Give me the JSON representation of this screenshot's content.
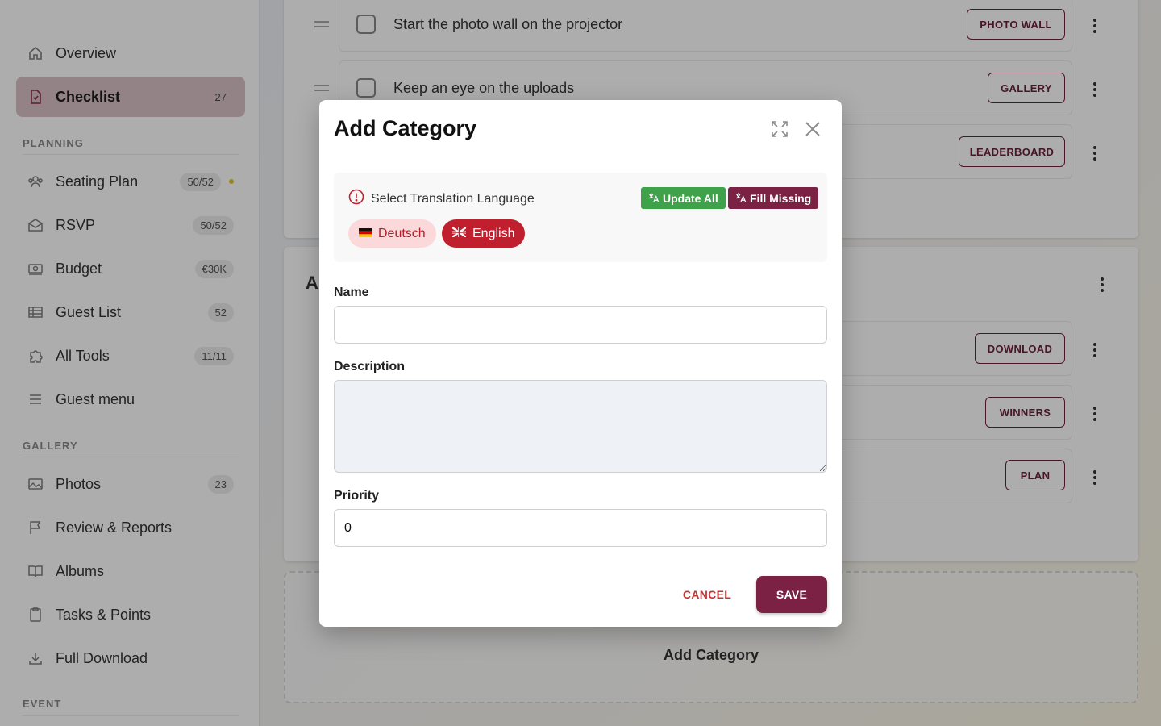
{
  "sidebar": {
    "overview": {
      "label": "Overview"
    },
    "checklist": {
      "label": "Checklist",
      "badge": "27"
    },
    "planning_head": "PLANNING",
    "seating": {
      "label": "Seating Plan",
      "badge": "50/52"
    },
    "rsvp": {
      "label": "RSVP",
      "badge": "50/52"
    },
    "budget": {
      "label": "Budget",
      "badge": "€30K"
    },
    "guest_list": {
      "label": "Guest List",
      "badge": "52"
    },
    "all_tools": {
      "label": "All Tools",
      "badge": "11/11"
    },
    "guest_menu": {
      "label": "Guest menu"
    },
    "gallery_head": "GALLERY",
    "photos": {
      "label": "Photos",
      "badge": "23"
    },
    "review": {
      "label": "Review & Reports"
    },
    "albums": {
      "label": "Albums"
    },
    "tasks": {
      "label": "Tasks & Points"
    },
    "download": {
      "label": "Full Download"
    },
    "event_head": "EVENT"
  },
  "main": {
    "row1": {
      "text": "Start the photo wall on the projector",
      "button": "PHOTO WALL"
    },
    "row2": {
      "text": "Keep an eye on the uploads",
      "button": "GALLERY"
    },
    "row3": {
      "button": "LEADERBOARD"
    },
    "section_initial": "A",
    "row4": {
      "button": "DOWNLOAD"
    },
    "row5": {
      "button": "WINNERS"
    },
    "row6": {
      "button": "PLAN"
    },
    "add_category": "Add Category"
  },
  "modal": {
    "title": "Add Category",
    "translation": {
      "label": "Select Translation Language",
      "update_all": "Update All",
      "fill_missing": "Fill Missing",
      "languages": [
        {
          "label": "Deutsch",
          "selected": false
        },
        {
          "label": "English",
          "selected": true
        }
      ]
    },
    "name": {
      "label": "Name",
      "value": ""
    },
    "description": {
      "label": "Description",
      "value": ""
    },
    "priority": {
      "label": "Priority",
      "value": "0"
    },
    "cancel": "CANCEL",
    "save": "SAVE"
  },
  "colors": {
    "accent": "#7b2244",
    "update_green": "#3fa24a",
    "english_red": "#c0202e",
    "cancel_red": "#c73333"
  }
}
